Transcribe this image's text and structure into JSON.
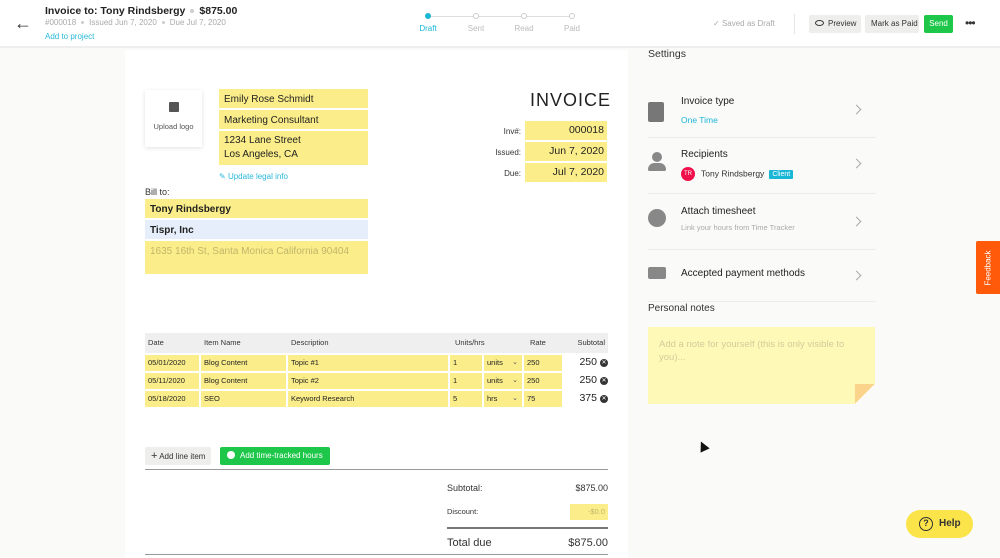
{
  "header": {
    "title": "Invoice to: Tony Rindsbergy",
    "amount": "$875.00",
    "invoice_number": "#000018",
    "issued": "Issued Jun 7, 2020",
    "due": "Due Jul 7, 2020",
    "add_to_project": "Add to project",
    "saved_status": "Saved as Draft",
    "preview_label": "Preview",
    "mark_paid_label": "Mark as Paid",
    "send_label": "Send",
    "more_label": "•••"
  },
  "steps": [
    {
      "label": "Draft",
      "active": true
    },
    {
      "label": "Sent",
      "active": false
    },
    {
      "label": "Read",
      "active": false
    },
    {
      "label": "Paid",
      "active": false
    }
  ],
  "document": {
    "upload_logo": "Upload logo",
    "from": {
      "name": "Emily Rose Schmidt",
      "title": "Marketing Consultant",
      "address_line1": "1234 Lane Street",
      "address_line2": "Los Angeles, CA"
    },
    "update_legal": "Update legal info",
    "bill_to_label": "Bill to:",
    "bill_to": {
      "name": "Tony Rindsbergy",
      "company": "Tispr, Inc",
      "address_placeholder": "1635 16th St, Santa Monica California 90404"
    },
    "invoice_heading": "INVOICE",
    "meta": [
      {
        "label": "Inv#:",
        "value": "000018"
      },
      {
        "label": "Issued:",
        "value": "Jun 7, 2020"
      },
      {
        "label": "Due:",
        "value": "Jul 7, 2020"
      }
    ],
    "table": {
      "headers": {
        "date": "Date",
        "item": "Item Name",
        "description": "Description",
        "units": "Units/hrs",
        "rate": "Rate",
        "subtotal": "Subtotal"
      },
      "rows": [
        {
          "date": "05/01/2020",
          "item": "Blog Content",
          "description": "Topic #1",
          "qty": "1",
          "unit": "units",
          "rate": "250",
          "subtotal": "250"
        },
        {
          "date": "05/11/2020",
          "item": "Blog Content",
          "description": "Topic #2",
          "qty": "1",
          "unit": "units",
          "rate": "250",
          "subtotal": "250"
        },
        {
          "date": "05/18/2020",
          "item": "SEO",
          "description": "Keyword Research",
          "qty": "5",
          "unit": "hrs",
          "rate": "75",
          "subtotal": "375"
        }
      ]
    },
    "add_line_item": "Add line item",
    "add_time_tracked": "Add time-tracked hours",
    "totals": {
      "subtotal_label": "Subtotal:",
      "subtotal_value": "$875.00",
      "discount_label": "Discount:",
      "discount_value": "-$0.0",
      "total_label": "Total due",
      "total_value": "$875.00"
    }
  },
  "settings": {
    "title": "Settings",
    "invoice_type_label": "Invoice type",
    "invoice_type_value": "One Time",
    "recipients_label": "Recipients",
    "recipient_initials": "TR",
    "recipient_name": "Tony Rindsbergy",
    "recipient_badge": "Client",
    "timesheet_label": "Attach timesheet",
    "timesheet_sub": "Link your hours from Time Tracker",
    "payment_label": "Accepted payment methods",
    "notes_title": "Personal notes",
    "notes_placeholder": "Add a note for yourself (this is only visible to you)..."
  },
  "feedback_label": "Feedback",
  "help_label": "Help",
  "colors": {
    "accent": "#1ab6d6",
    "send_green": "#1ec74a",
    "field_yellow": "#fbee8a",
    "feedback_orange": "#ff5a0a",
    "help_yellow": "#fbe34a",
    "avatar_red": "#f0114a"
  }
}
